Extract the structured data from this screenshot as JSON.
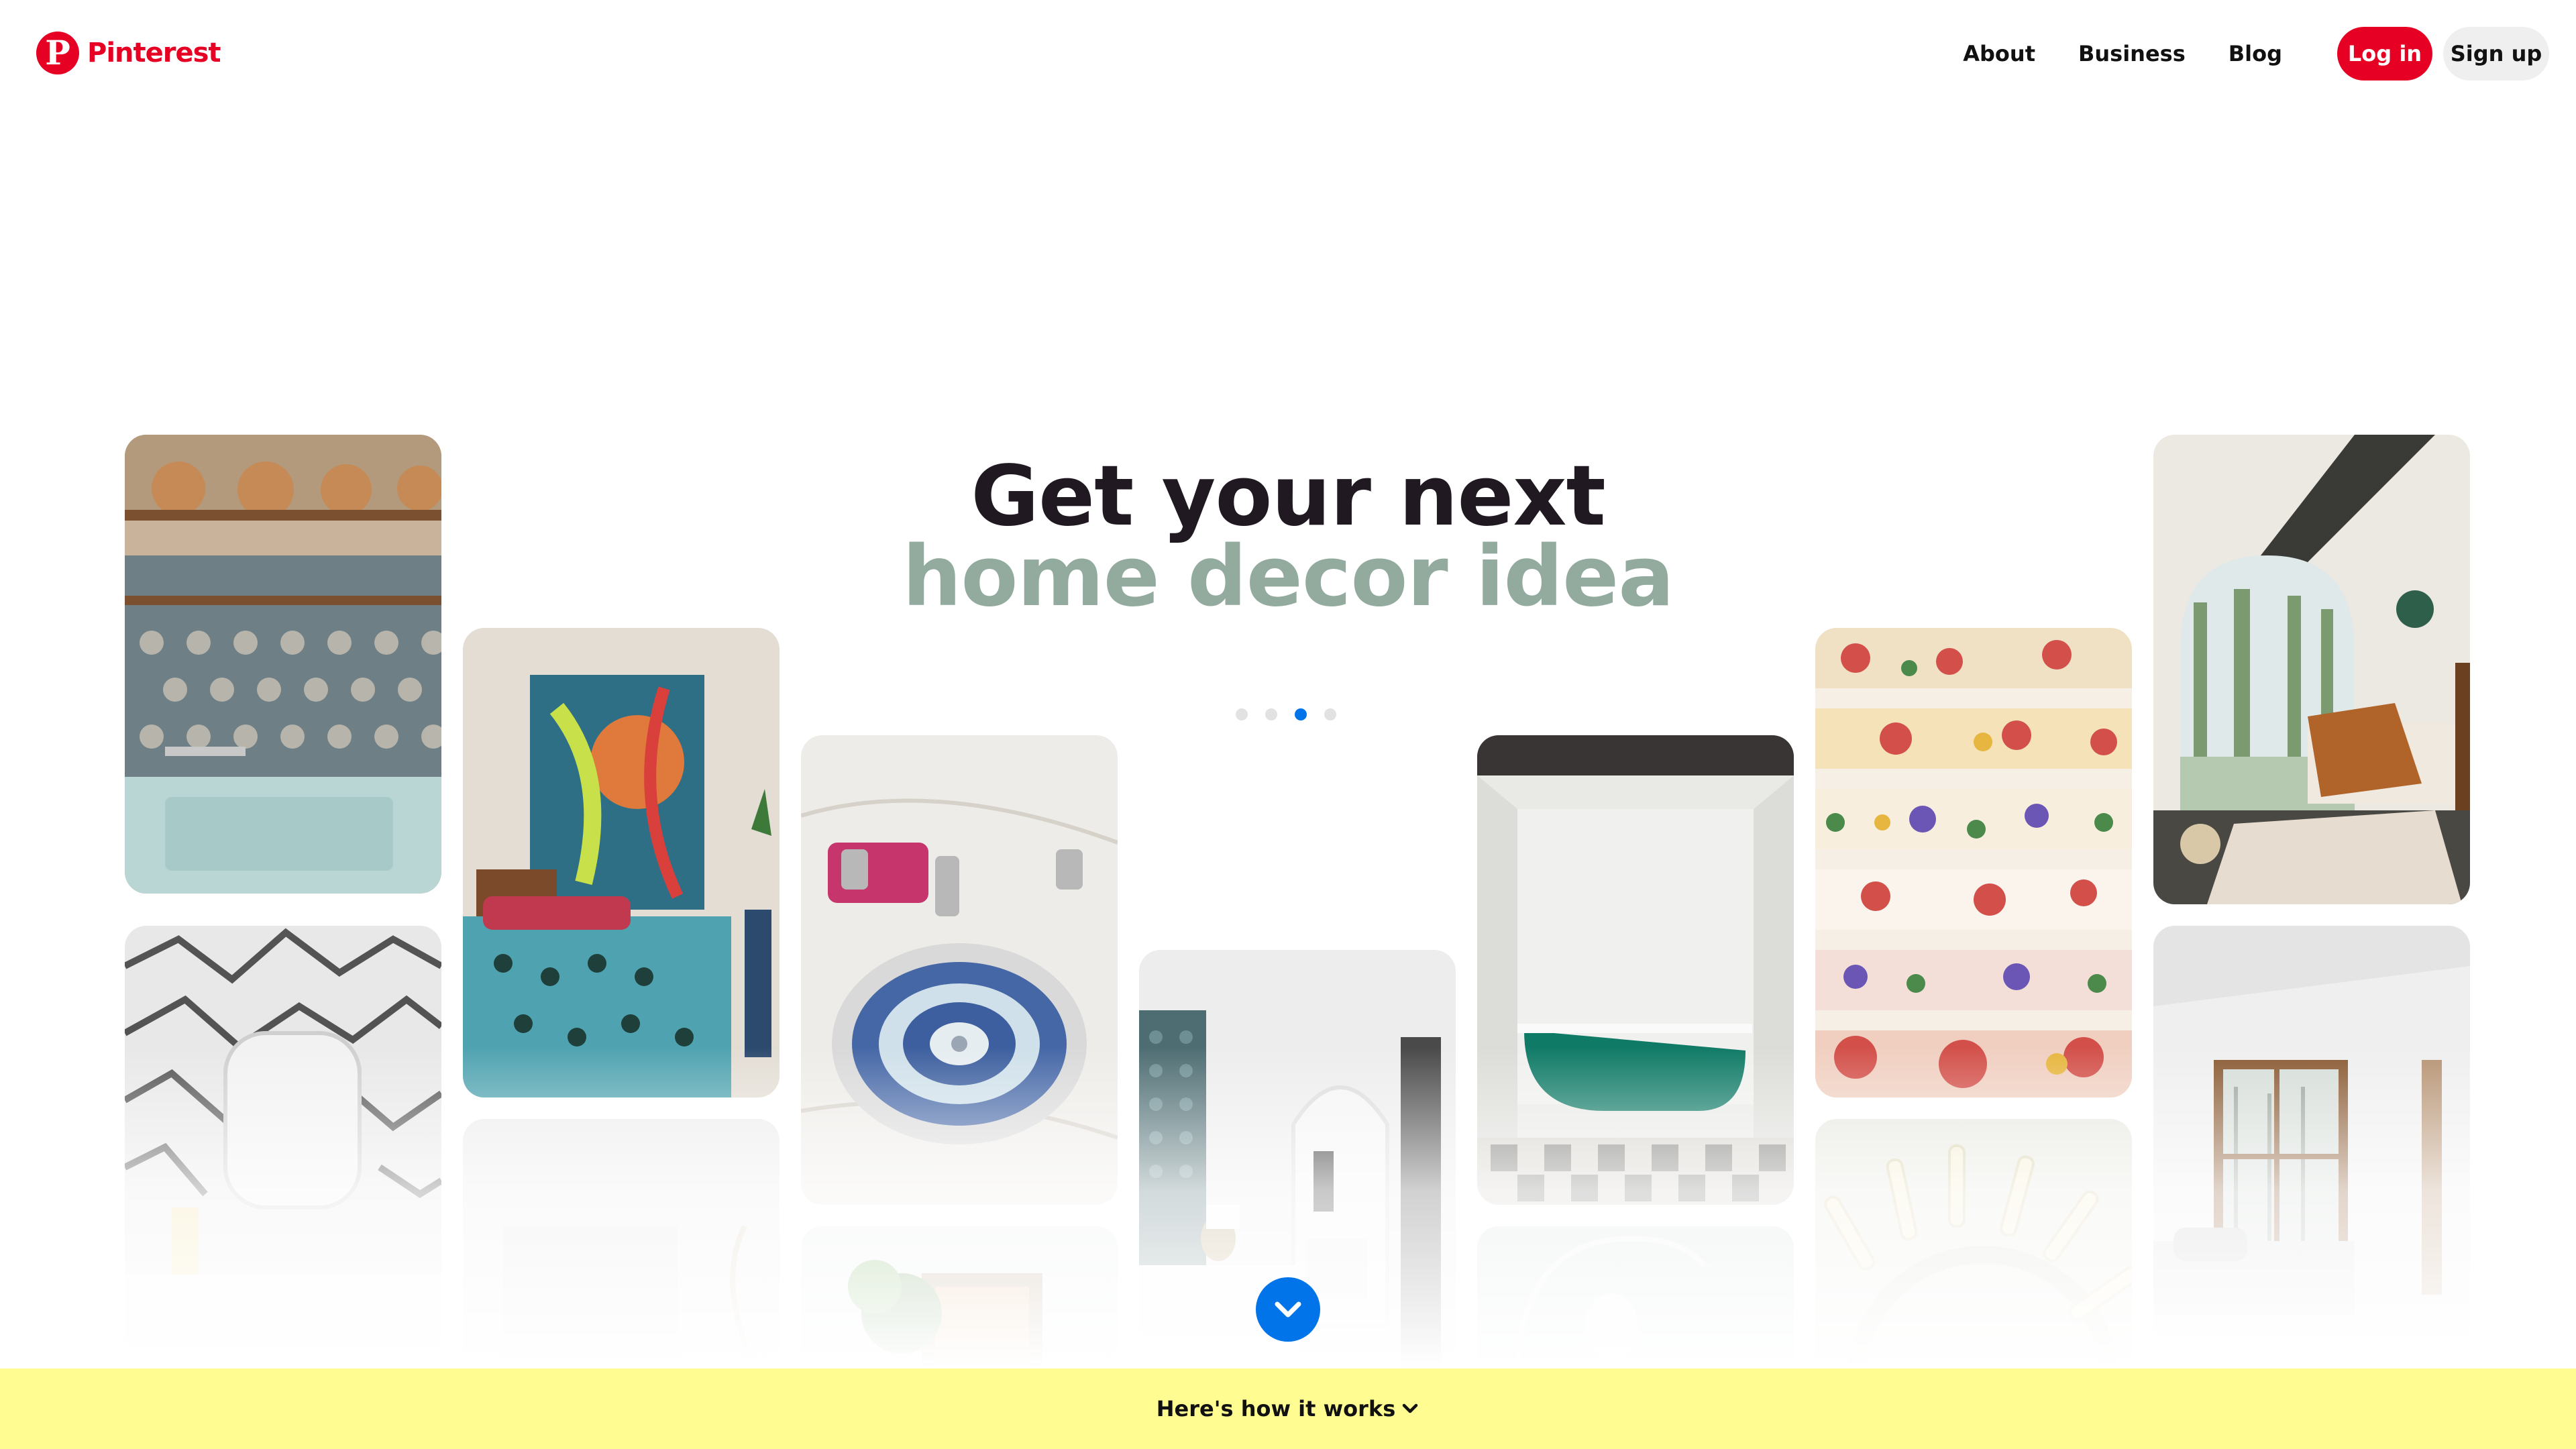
{
  "brand": {
    "name": "Pinterest",
    "logo_icon": "pinterest-logo-icon",
    "color": "#e60023"
  },
  "nav": {
    "links": [
      "About",
      "Business",
      "Blog"
    ],
    "login_label": "Log in",
    "signup_label": "Sign up"
  },
  "hero": {
    "headline": "Get your next",
    "topic": "home decor idea",
    "topic_color": "#93ab9f",
    "carousel": {
      "total": 4,
      "active": 3,
      "active_color": "#0074e8"
    }
  },
  "pins": [
    "tiled-kitchen-sink-copper-pots",
    "patterned-bathroom-mirror",
    "teal-bedroom-abstract-art",
    "white-minimal-room",
    "mosaic-sink-basin",
    "plant-shelf-decor",
    "white-bathroom-arch-bed",
    "green-clawfoot-bathtub",
    "arc-floor-lamp",
    "floral-staircase",
    "light-sculpture-wall",
    "arched-window-bedroom",
    "minimal-bedroom-large-window"
  ],
  "scroll_button_icon": "chevron-down-icon",
  "footer_bar": {
    "label": "Here's how it works",
    "icon": "chevron-down-icon",
    "color": "#fffd92"
  }
}
